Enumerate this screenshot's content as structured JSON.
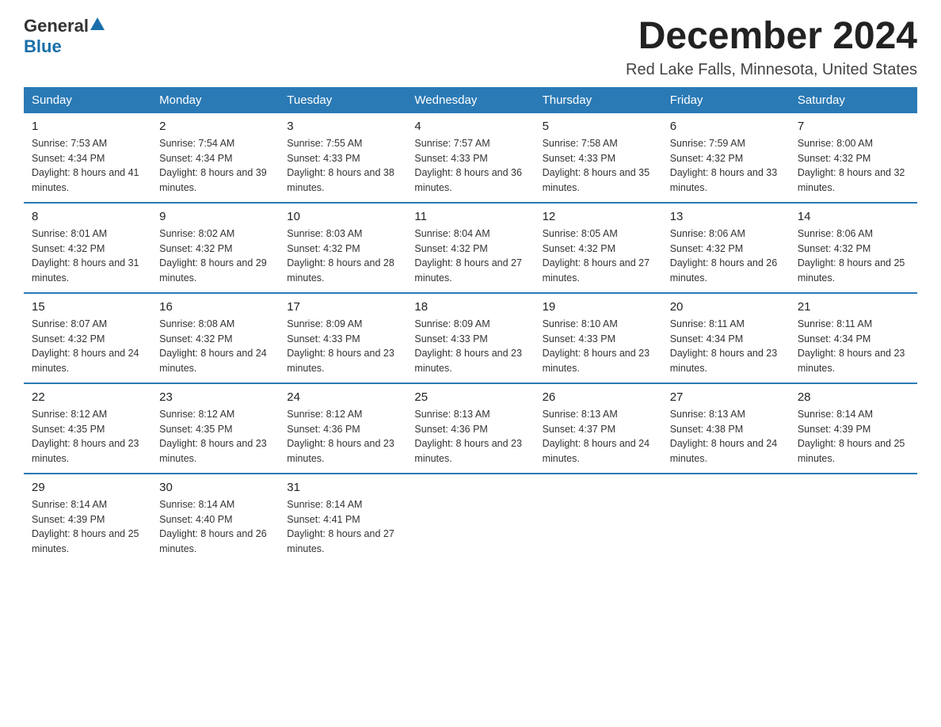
{
  "header": {
    "logo_general": "General",
    "logo_blue": "Blue",
    "month_year": "December 2024",
    "location": "Red Lake Falls, Minnesota, United States"
  },
  "weekdays": [
    "Sunday",
    "Monday",
    "Tuesday",
    "Wednesday",
    "Thursday",
    "Friday",
    "Saturday"
  ],
  "weeks": [
    [
      {
        "day": "1",
        "sunrise": "7:53 AM",
        "sunset": "4:34 PM",
        "daylight": "8 hours and 41 minutes."
      },
      {
        "day": "2",
        "sunrise": "7:54 AM",
        "sunset": "4:34 PM",
        "daylight": "8 hours and 39 minutes."
      },
      {
        "day": "3",
        "sunrise": "7:55 AM",
        "sunset": "4:33 PM",
        "daylight": "8 hours and 38 minutes."
      },
      {
        "day": "4",
        "sunrise": "7:57 AM",
        "sunset": "4:33 PM",
        "daylight": "8 hours and 36 minutes."
      },
      {
        "day": "5",
        "sunrise": "7:58 AM",
        "sunset": "4:33 PM",
        "daylight": "8 hours and 35 minutes."
      },
      {
        "day": "6",
        "sunrise": "7:59 AM",
        "sunset": "4:32 PM",
        "daylight": "8 hours and 33 minutes."
      },
      {
        "day": "7",
        "sunrise": "8:00 AM",
        "sunset": "4:32 PM",
        "daylight": "8 hours and 32 minutes."
      }
    ],
    [
      {
        "day": "8",
        "sunrise": "8:01 AM",
        "sunset": "4:32 PM",
        "daylight": "8 hours and 31 minutes."
      },
      {
        "day": "9",
        "sunrise": "8:02 AM",
        "sunset": "4:32 PM",
        "daylight": "8 hours and 29 minutes."
      },
      {
        "day": "10",
        "sunrise": "8:03 AM",
        "sunset": "4:32 PM",
        "daylight": "8 hours and 28 minutes."
      },
      {
        "day": "11",
        "sunrise": "8:04 AM",
        "sunset": "4:32 PM",
        "daylight": "8 hours and 27 minutes."
      },
      {
        "day": "12",
        "sunrise": "8:05 AM",
        "sunset": "4:32 PM",
        "daylight": "8 hours and 27 minutes."
      },
      {
        "day": "13",
        "sunrise": "8:06 AM",
        "sunset": "4:32 PM",
        "daylight": "8 hours and 26 minutes."
      },
      {
        "day": "14",
        "sunrise": "8:06 AM",
        "sunset": "4:32 PM",
        "daylight": "8 hours and 25 minutes."
      }
    ],
    [
      {
        "day": "15",
        "sunrise": "8:07 AM",
        "sunset": "4:32 PM",
        "daylight": "8 hours and 24 minutes."
      },
      {
        "day": "16",
        "sunrise": "8:08 AM",
        "sunset": "4:32 PM",
        "daylight": "8 hours and 24 minutes."
      },
      {
        "day": "17",
        "sunrise": "8:09 AM",
        "sunset": "4:33 PM",
        "daylight": "8 hours and 23 minutes."
      },
      {
        "day": "18",
        "sunrise": "8:09 AM",
        "sunset": "4:33 PM",
        "daylight": "8 hours and 23 minutes."
      },
      {
        "day": "19",
        "sunrise": "8:10 AM",
        "sunset": "4:33 PM",
        "daylight": "8 hours and 23 minutes."
      },
      {
        "day": "20",
        "sunrise": "8:11 AM",
        "sunset": "4:34 PM",
        "daylight": "8 hours and 23 minutes."
      },
      {
        "day": "21",
        "sunrise": "8:11 AM",
        "sunset": "4:34 PM",
        "daylight": "8 hours and 23 minutes."
      }
    ],
    [
      {
        "day": "22",
        "sunrise": "8:12 AM",
        "sunset": "4:35 PM",
        "daylight": "8 hours and 23 minutes."
      },
      {
        "day": "23",
        "sunrise": "8:12 AM",
        "sunset": "4:35 PM",
        "daylight": "8 hours and 23 minutes."
      },
      {
        "day": "24",
        "sunrise": "8:12 AM",
        "sunset": "4:36 PM",
        "daylight": "8 hours and 23 minutes."
      },
      {
        "day": "25",
        "sunrise": "8:13 AM",
        "sunset": "4:36 PM",
        "daylight": "8 hours and 23 minutes."
      },
      {
        "day": "26",
        "sunrise": "8:13 AM",
        "sunset": "4:37 PM",
        "daylight": "8 hours and 24 minutes."
      },
      {
        "day": "27",
        "sunrise": "8:13 AM",
        "sunset": "4:38 PM",
        "daylight": "8 hours and 24 minutes."
      },
      {
        "day": "28",
        "sunrise": "8:14 AM",
        "sunset": "4:39 PM",
        "daylight": "8 hours and 25 minutes."
      }
    ],
    [
      {
        "day": "29",
        "sunrise": "8:14 AM",
        "sunset": "4:39 PM",
        "daylight": "8 hours and 25 minutes."
      },
      {
        "day": "30",
        "sunrise": "8:14 AM",
        "sunset": "4:40 PM",
        "daylight": "8 hours and 26 minutes."
      },
      {
        "day": "31",
        "sunrise": "8:14 AM",
        "sunset": "4:41 PM",
        "daylight": "8 hours and 27 minutes."
      },
      null,
      null,
      null,
      null
    ]
  ]
}
